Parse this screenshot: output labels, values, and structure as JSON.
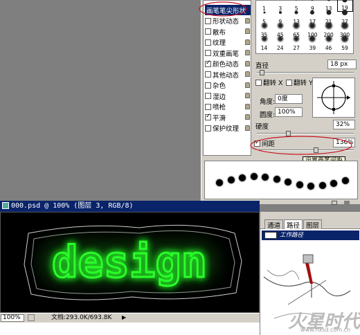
{
  "brush_panel": {
    "items": [
      {
        "label": "画笔笔尖形状",
        "checkbox": false,
        "selected": true
      },
      {
        "label": "形状动态",
        "checkbox": true,
        "checked": false,
        "lock": true
      },
      {
        "label": "散布",
        "checkbox": true,
        "checked": false,
        "lock": true
      },
      {
        "label": "纹理",
        "checkbox": true,
        "checked": false,
        "lock": true
      },
      {
        "label": "双重画笔",
        "checkbox": true,
        "checked": false,
        "lock": true
      },
      {
        "label": "颜色动态",
        "checkbox": true,
        "checked": true,
        "lock": true
      },
      {
        "label": "其他动态",
        "checkbox": true,
        "checked": false,
        "lock": true
      },
      {
        "label": "杂色",
        "checkbox": true,
        "checked": false,
        "lock": true
      },
      {
        "label": "湿边",
        "checkbox": true,
        "checked": false,
        "lock": true
      },
      {
        "label": "喷枪",
        "checkbox": true,
        "checked": false,
        "lock": true
      },
      {
        "label": "平滑",
        "checkbox": true,
        "checked": true,
        "lock": true
      },
      {
        "label": "保护纹理",
        "checkbox": true,
        "checked": false,
        "lock": true
      }
    ],
    "tips": [
      {
        "num": "1",
        "size": 1
      },
      {
        "num": "3",
        "size": 2
      },
      {
        "num": "5",
        "size": 3
      },
      {
        "num": "9",
        "size": 4
      },
      {
        "num": "13",
        "size": 5
      },
      {
        "num": "19",
        "size": 7
      },
      {
        "num": "5",
        "size": 3
      },
      {
        "num": "9",
        "size": 4
      },
      {
        "num": "13",
        "size": 5
      },
      {
        "num": "17",
        "size": 6
      },
      {
        "num": "21",
        "size": 7
      },
      {
        "num": "27",
        "size": 8
      },
      {
        "num": "35",
        "size": 8
      },
      {
        "num": "45",
        "size": 8
      },
      {
        "num": "65",
        "size": 9
      },
      {
        "num": "100",
        "size": 9
      },
      {
        "num": "200",
        "size": 10
      },
      {
        "num": "300",
        "size": 10
      },
      {
        "num": "14",
        "size": 8
      },
      {
        "num": "24",
        "size": 8
      },
      {
        "num": "27",
        "size": 8
      },
      {
        "num": "39",
        "size": 9
      },
      {
        "num": "46",
        "size": 9
      },
      {
        "num": "59",
        "size": 10
      }
    ],
    "diameter_label": "直径",
    "diameter_value": "18 px",
    "flip_x_label": "翻转 X",
    "flip_y_label": "翻转 Y",
    "angle_label": "角度:",
    "angle_value": "0度",
    "roundness_label": "圆度:",
    "roundness_value": "100%",
    "hardness_label": "硬度",
    "hardness_value": "32%",
    "spacing_label": "间距",
    "spacing_value": "136%",
    "spacing_checked": true,
    "tooltip": "设置画笔间距"
  },
  "document": {
    "title": "000.psd @ 100% (图层 3, RGB/8)",
    "artwork_text": "design",
    "zoom": "100%",
    "doc_info": "文档:293.0K/693.8K",
    "glow_color": "#2bff2b"
  },
  "paths_panel": {
    "tabs": [
      "通道",
      "路径",
      "图层"
    ],
    "active_tab": 1,
    "work_path_label": "工作路径"
  },
  "watermark": {
    "brand": "火星时代",
    "url": "www.hxsd.com.cn"
  }
}
